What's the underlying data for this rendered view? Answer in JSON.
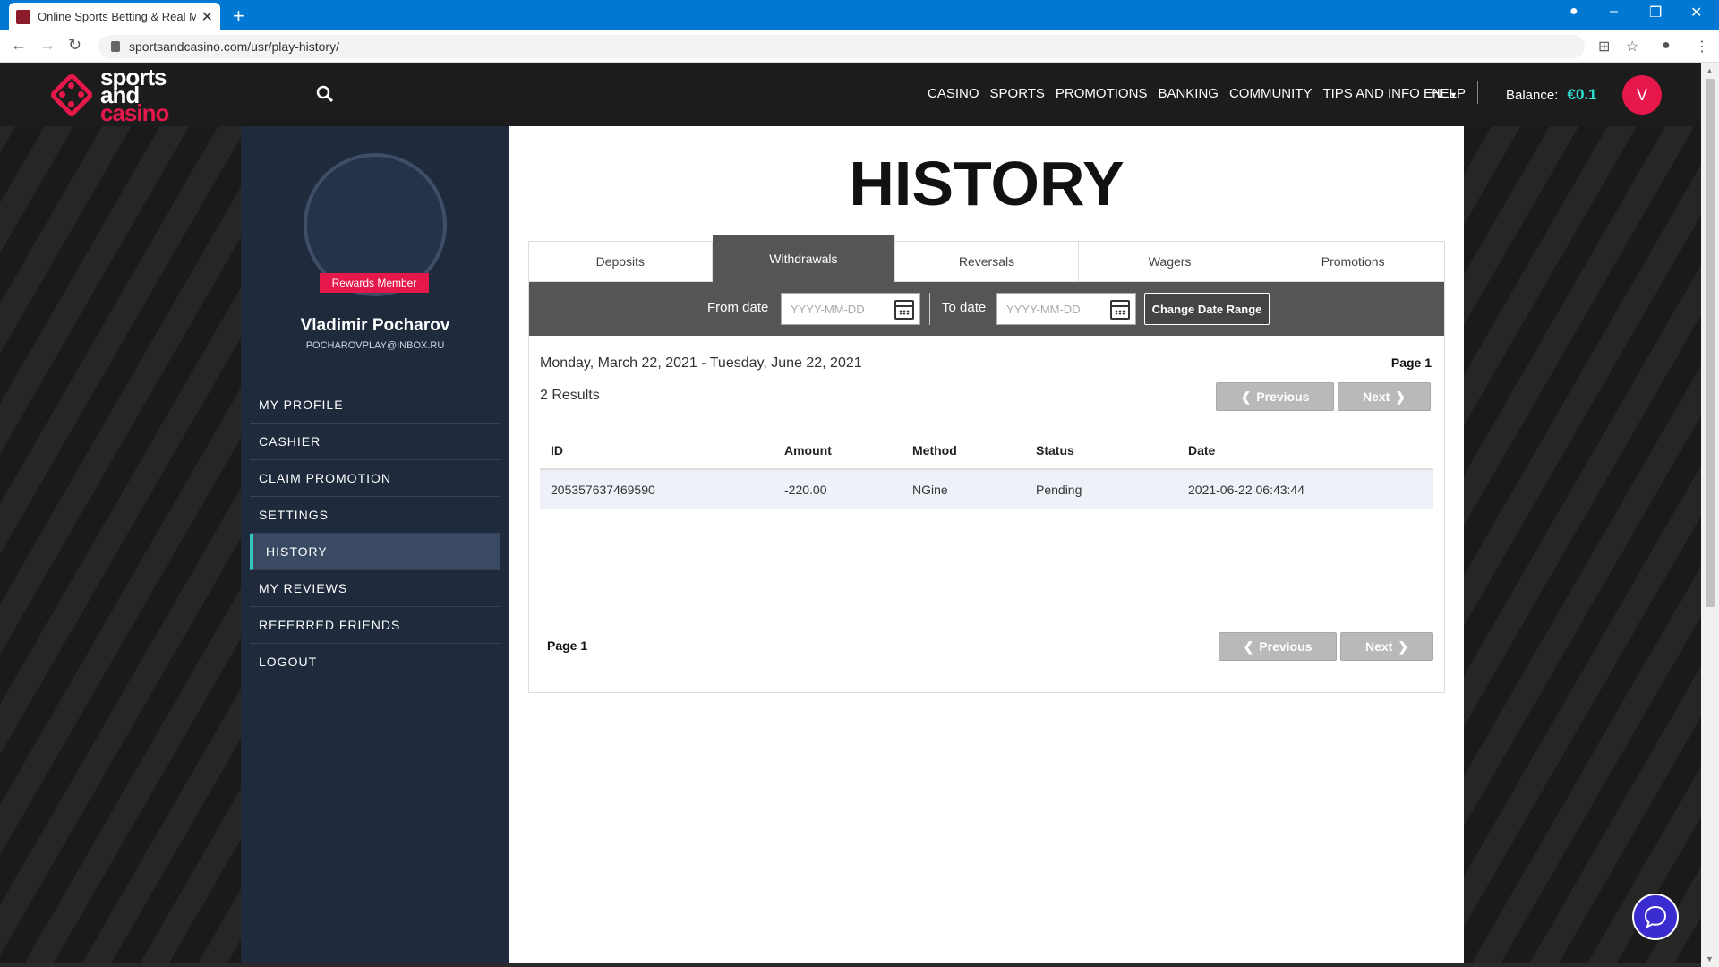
{
  "browser": {
    "tab_title": "Online Sports Betting & Real Mo",
    "url": "sportsandcasino.com/usr/play-history/"
  },
  "header": {
    "logo_line1": "sports",
    "logo_line2": "and",
    "logo_line3": "casino",
    "nav": [
      "CASINO",
      "SPORTS",
      "PROMOTIONS",
      "BANKING",
      "COMMUNITY",
      "TIPS AND INFO",
      "HELP"
    ],
    "lang": "EN",
    "balance_label": "Balance:",
    "balance_value": "€0.1",
    "avatar_letter": "V"
  },
  "sidebar": {
    "badge": "Rewards Member",
    "name": "Vladimir Pocharov",
    "email": "POCHAROVPLAY@INBOX.RU",
    "items": [
      "MY PROFILE",
      "CASHIER",
      "CLAIM PROMOTION",
      "SETTINGS",
      "HISTORY",
      "MY REVIEWS",
      "REFERRED FRIENDS",
      "LOGOUT"
    ],
    "active": "HISTORY"
  },
  "main": {
    "title": "HISTORY",
    "tabs": [
      "Deposits",
      "Withdrawals",
      "Reversals",
      "Wagers",
      "Promotions"
    ],
    "active_tab": "Withdrawals",
    "from_label": "From date",
    "to_label": "To date",
    "from_placeholder": "YYYY-MM-DD",
    "to_placeholder": "YYYY-MM-DD",
    "change_btn": "Change Date Range",
    "range_text": "Monday, March 22, 2021 - Tuesday, June 22, 2021",
    "page_label": "Page 1",
    "results": "2 Results",
    "prev": "Previous",
    "next": "Next",
    "columns": [
      "ID",
      "Amount",
      "Method",
      "Status",
      "Date"
    ],
    "rows": [
      [
        "205357637469590",
        "-220.00",
        "NGine",
        "Pending",
        "2021-06-22 06:43:44"
      ]
    ],
    "page_bottom": "Page 1"
  },
  "colors": {
    "brand": "#e6174a",
    "accent": "#2ee6d6",
    "sidebar": "#1f2b3d"
  }
}
